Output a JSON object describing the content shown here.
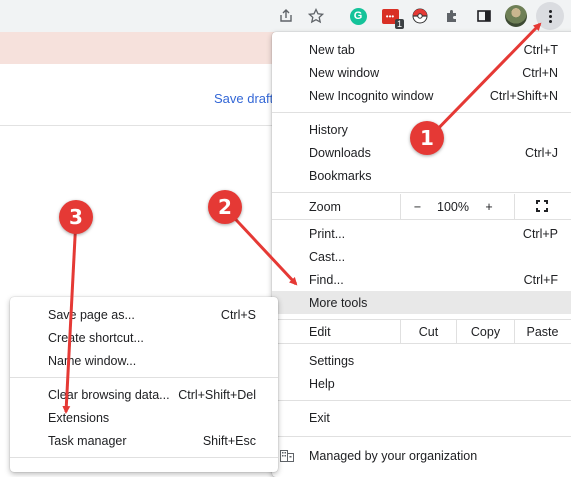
{
  "toolbar": {
    "icons": [
      "share-icon",
      "star-icon",
      "grammarly-icon",
      "extension-red-icon",
      "pokeball-icon",
      "puzzle-icon",
      "sidepanel-icon"
    ],
    "badge": "1",
    "grammarly_letter": "G",
    "ext_dots": "•••"
  },
  "page": {
    "save_draft": "Save draft"
  },
  "menu": {
    "new_tab": {
      "label": "New tab",
      "shortcut": "Ctrl+T"
    },
    "new_window": {
      "label": "New window",
      "shortcut": "Ctrl+N"
    },
    "new_incognito": {
      "label": "New Incognito window",
      "shortcut": "Ctrl+Shift+N"
    },
    "history": {
      "label": "History"
    },
    "downloads": {
      "label": "Downloads",
      "shortcut": "Ctrl+J"
    },
    "bookmarks": {
      "label": "Bookmarks"
    },
    "zoom": {
      "label": "Zoom",
      "minus": "−",
      "value": "100%",
      "plus": "+"
    },
    "print": {
      "label": "Print...",
      "shortcut": "Ctrl+P"
    },
    "cast": {
      "label": "Cast..."
    },
    "find": {
      "label": "Find...",
      "shortcut": "Ctrl+F"
    },
    "more_tools": {
      "label": "More tools"
    },
    "edit": {
      "label": "Edit",
      "cut": "Cut",
      "copy": "Copy",
      "paste": "Paste"
    },
    "settings": {
      "label": "Settings"
    },
    "help": {
      "label": "Help"
    },
    "exit": {
      "label": "Exit"
    },
    "managed": {
      "label": "Managed by your organization"
    }
  },
  "submenu": {
    "save_page": {
      "label": "Save page as...",
      "shortcut": "Ctrl+S"
    },
    "create_shortcut": {
      "label": "Create shortcut..."
    },
    "name_window": {
      "label": "Name window..."
    },
    "clear_browsing": {
      "label": "Clear browsing data...",
      "shortcut": "Ctrl+Shift+Del"
    },
    "extensions": {
      "label": "Extensions"
    },
    "task_manager": {
      "label": "Task manager",
      "shortcut": "Shift+Esc"
    }
  },
  "callouts": [
    "1",
    "2",
    "3"
  ],
  "colors": {
    "callout": "#e53935",
    "link": "#3367d6",
    "highlight": "#e8e8e8"
  }
}
